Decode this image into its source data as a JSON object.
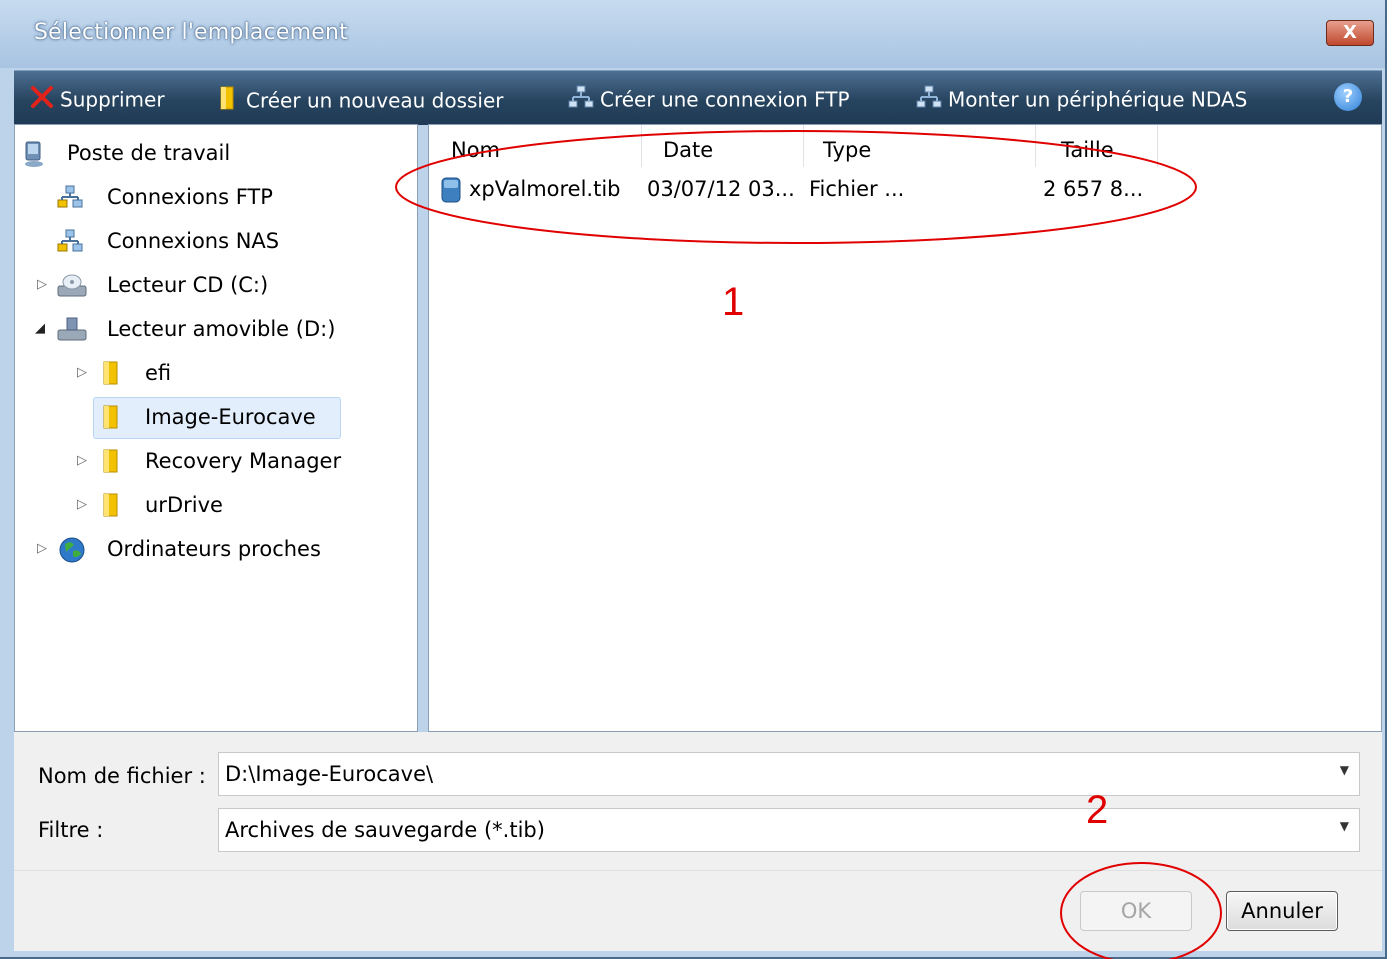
{
  "window": {
    "title": "Sélectionner l'emplacement",
    "close_label": "X"
  },
  "toolbar": {
    "delete_label": "Supprimer",
    "new_folder_label": "Créer un nouveau dossier",
    "ftp_label": "Créer une connexion FTP",
    "ndas_label": "Monter un périphérique NDAS",
    "help_label": "?"
  },
  "tree": {
    "items": [
      {
        "label": "Poste de travail",
        "icon": "computer-icon"
      },
      {
        "label": "Connexions FTP",
        "icon": "network-icon"
      },
      {
        "label": "Connexions NAS",
        "icon": "network-icon"
      },
      {
        "label": "Lecteur CD (C:)",
        "icon": "cd-drive-icon"
      },
      {
        "label": "Lecteur amovible (D:)",
        "icon": "removable-drive-icon"
      },
      {
        "label": "efi",
        "icon": "folder-icon"
      },
      {
        "label": "Image-Eurocave",
        "icon": "folder-icon",
        "selected": true
      },
      {
        "label": "Recovery Manager",
        "icon": "folder-icon"
      },
      {
        "label": "urDrive",
        "icon": "folder-icon"
      },
      {
        "label": "Ordinateurs proches",
        "icon": "globe-icon"
      }
    ]
  },
  "file_list": {
    "columns": [
      "Nom",
      "Date",
      "Type",
      "Taille"
    ],
    "rows": [
      {
        "name": "xpValmorel.tib",
        "date": "03/07/12 03...",
        "type": "Fichier ...",
        "size": "2 657 8..."
      }
    ]
  },
  "form": {
    "filename_label": "Nom de fichier :",
    "filename_value": "D:\\Image-Eurocave\\",
    "filter_label": "Filtre :",
    "filter_value": "Archives de sauvegarde (*.tib)"
  },
  "buttons": {
    "ok_label": "OK",
    "cancel_label": "Annuler"
  },
  "annotations": {
    "marker_1": "1",
    "marker_2": "2",
    "color": "#e00000"
  }
}
